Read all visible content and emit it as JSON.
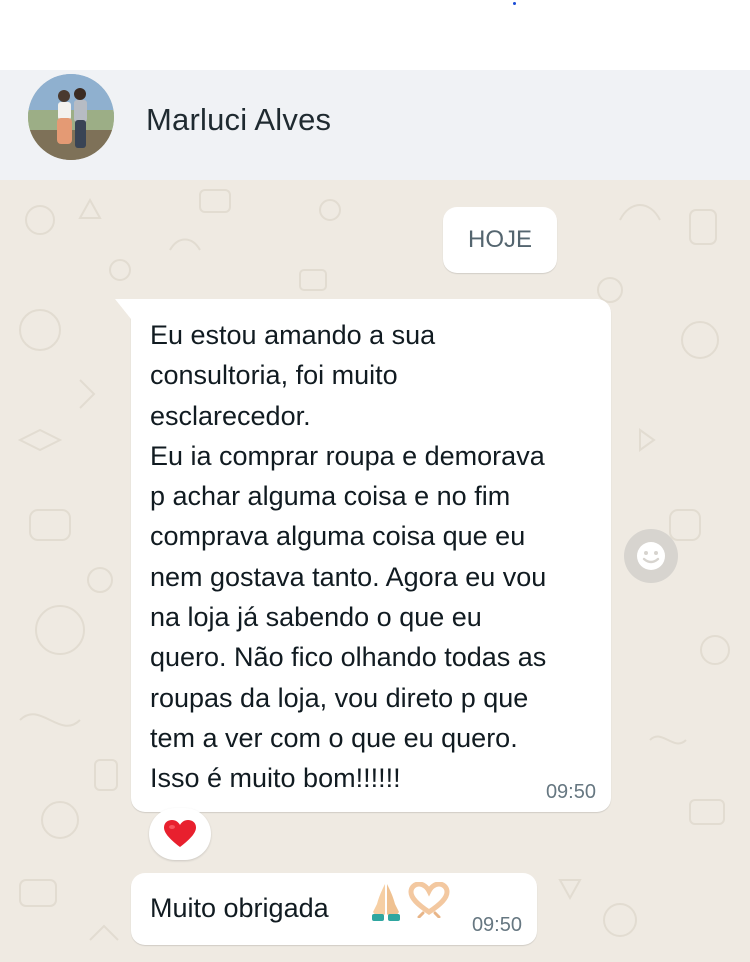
{
  "header": {
    "contact_name": "Marluci Alves"
  },
  "chat": {
    "date_label": "HOJE",
    "messages": [
      {
        "text": "Eu estou amando a sua\nconsultoria, foi muito\nesclarecedor.\nEu ia comprar roupa e demorava\np achar alguma coisa e no fim\ncomprava alguma coisa que eu\nnem gostava tanto. Agora eu vou\nna loja já sabendo o que eu\nquero. Não fico olhando todas as\nroupas da loja, vou direto p que\ntem a ver com o que eu quero.\nIsso é muito bom!!!!!!",
        "time": "09:50",
        "reaction": "heart-icon"
      },
      {
        "text": "Muito obrigada",
        "emojis": [
          "praying-hands-icon",
          "heart-hands-icon"
        ],
        "time": "09:50"
      }
    ]
  },
  "colors": {
    "header_bg": "#f0f2f5",
    "chat_bg": "#efeae2",
    "bubble_bg": "#ffffff",
    "time_text": "#667781",
    "reaction_heart": "#e8202e"
  }
}
